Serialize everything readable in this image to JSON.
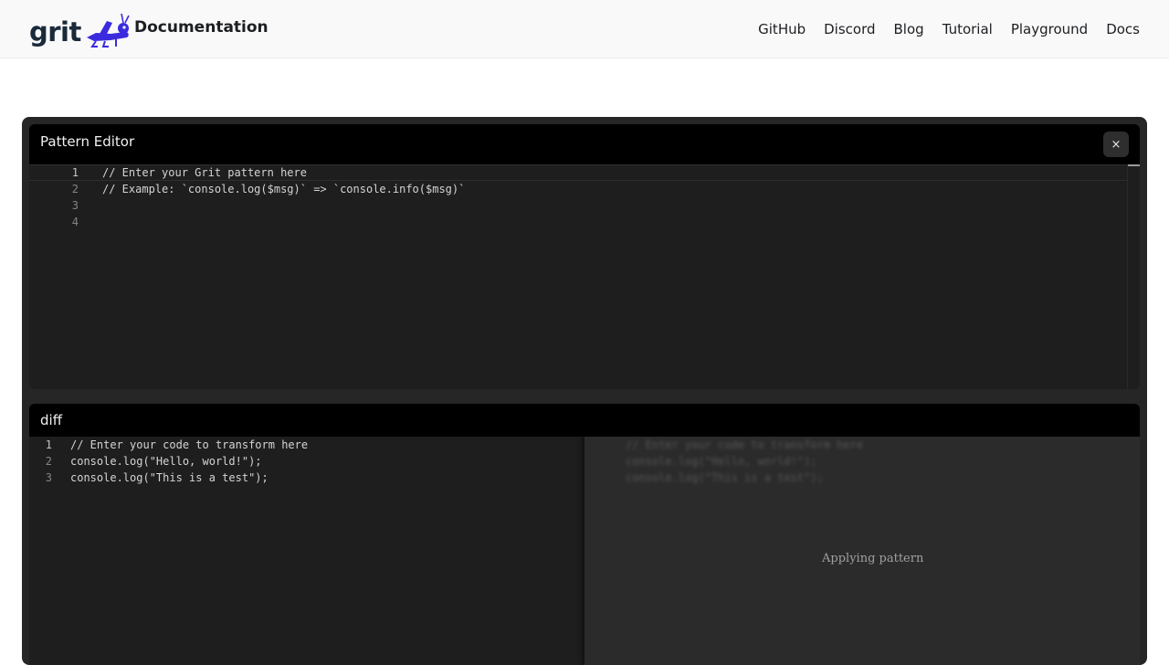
{
  "header": {
    "logo_text": "grit",
    "brand_title": "Documentation",
    "nav": [
      "GitHub",
      "Discord",
      "Blog",
      "Tutorial",
      "Playground",
      "Docs"
    ]
  },
  "pattern_editor": {
    "title": "Pattern Editor",
    "close_label": "×",
    "line_numbers": [
      "1",
      "2",
      "3",
      "4"
    ],
    "lines": [
      "// Enter your Grit pattern here",
      "// Example: `console.log($msg)` => `console.info($msg)`",
      "",
      ""
    ]
  },
  "diff": {
    "title": "diff",
    "line_numbers": [
      "1",
      "2",
      "3"
    ],
    "lines": [
      "// Enter your code to transform here",
      "console.log(\"Hello, world!\");",
      "console.log(\"This is a test\");"
    ],
    "status": "Applying pattern"
  },
  "colors": {
    "brand_accent": "#3b2bde",
    "editor_bg": "#1e1e1e",
    "panel_header_bg": "#000000"
  }
}
